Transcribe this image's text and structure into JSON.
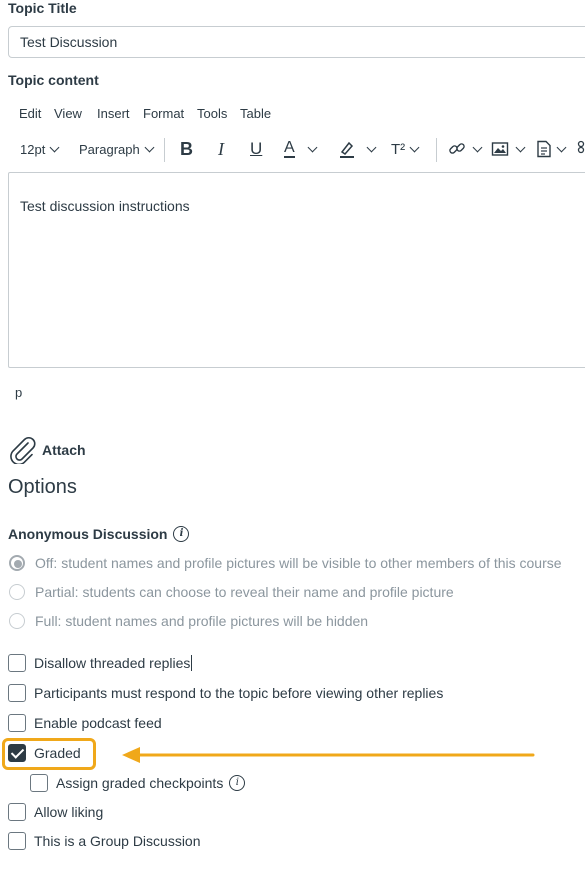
{
  "topic_title": {
    "label": "Topic Title",
    "value": "Test Discussion"
  },
  "topic_content": {
    "label": "Topic content",
    "menubar": [
      "Edit",
      "View",
      "Insert",
      "Format",
      "Tools",
      "Table"
    ],
    "toolbar": {
      "font_size": "12pt",
      "block_format": "Paragraph",
      "bold": "B",
      "italic": "I",
      "underline": "U",
      "text_color": "A",
      "superscript": "T²"
    },
    "body_text": "Test discussion instructions",
    "status_path": "p"
  },
  "attach": {
    "label": "Attach",
    "icon": "paperclip-icon"
  },
  "options": {
    "heading": "Options",
    "anonymous": {
      "label": "Anonymous Discussion",
      "choices": [
        {
          "label": "Off: student names and profile pictures will be visible to other members of this course",
          "checked": true
        },
        {
          "label": "Partial: students can choose to reveal their name and profile picture",
          "checked": false
        },
        {
          "label": "Full: student names and profile pictures will be hidden",
          "checked": false
        }
      ]
    },
    "checkboxes": {
      "disallow_threaded": {
        "label": "Disallow threaded replies",
        "checked": false
      },
      "must_respond": {
        "label": "Participants must respond to the topic before viewing other replies",
        "checked": false
      },
      "podcast": {
        "label": "Enable podcast feed",
        "checked": false
      },
      "graded": {
        "label": "Graded",
        "checked": true
      },
      "checkpoints": {
        "label": "Assign graded checkpoints",
        "checked": false
      },
      "liking": {
        "label": "Allow liking",
        "checked": false
      },
      "group": {
        "label": "This is a Group Discussion",
        "checked": false
      }
    }
  },
  "colors": {
    "highlight": "#f0a81a",
    "text": "#2d3b45",
    "disabled_text": "#8b969e"
  }
}
